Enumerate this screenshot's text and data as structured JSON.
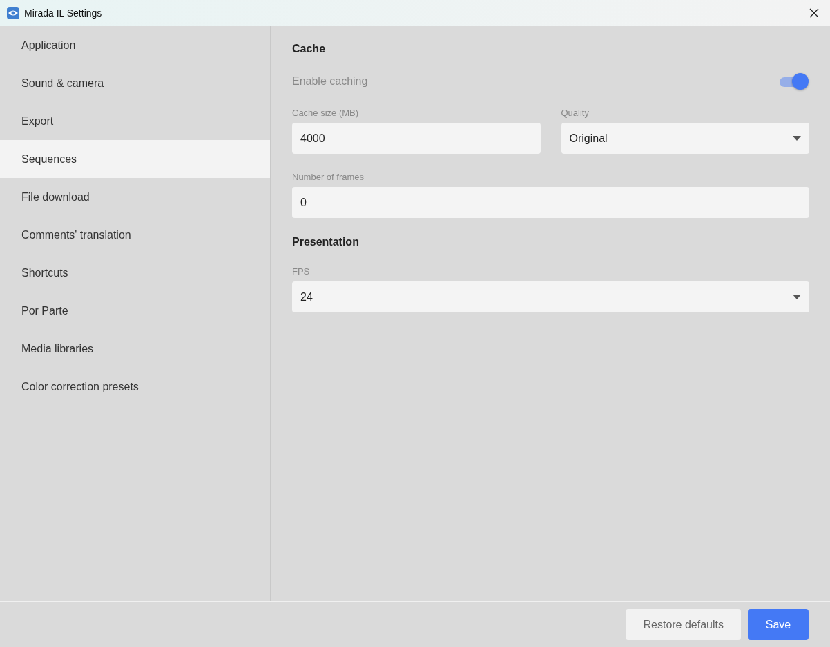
{
  "window": {
    "title": "Mirada IL Settings"
  },
  "sidebar": {
    "items": [
      {
        "label": "Application",
        "selected": false
      },
      {
        "label": "Sound & camera",
        "selected": false
      },
      {
        "label": "Export",
        "selected": false
      },
      {
        "label": "Sequences",
        "selected": true
      },
      {
        "label": "File download",
        "selected": false
      },
      {
        "label": "Comments' translation",
        "selected": false
      },
      {
        "label": "Shortcuts",
        "selected": false
      },
      {
        "label": "Por Parte",
        "selected": false
      },
      {
        "label": "Media libraries",
        "selected": false
      },
      {
        "label": "Color correction presets",
        "selected": false
      }
    ]
  },
  "sections": [
    {
      "title": "Cache",
      "rows": [
        {
          "kind": "toggle",
          "label": "Enable caching",
          "on": true
        },
        {
          "kind": "fields",
          "fields": [
            {
              "kind": "input",
              "label": "Cache size (MB)",
              "value": "4000"
            },
            {
              "kind": "select",
              "label": "Quality",
              "value": "Original"
            }
          ]
        },
        {
          "kind": "fields",
          "fields": [
            {
              "kind": "input",
              "label": "Number of frames",
              "value": "0"
            }
          ]
        }
      ]
    },
    {
      "title": "Presentation",
      "rows": [
        {
          "kind": "fields",
          "fields": [
            {
              "kind": "select",
              "label": "FPS",
              "value": "24"
            }
          ]
        }
      ]
    }
  ],
  "footer": {
    "buttons": [
      {
        "label": "Restore defaults",
        "kind": "secondary"
      },
      {
        "label": "Save",
        "kind": "primary"
      }
    ]
  }
}
